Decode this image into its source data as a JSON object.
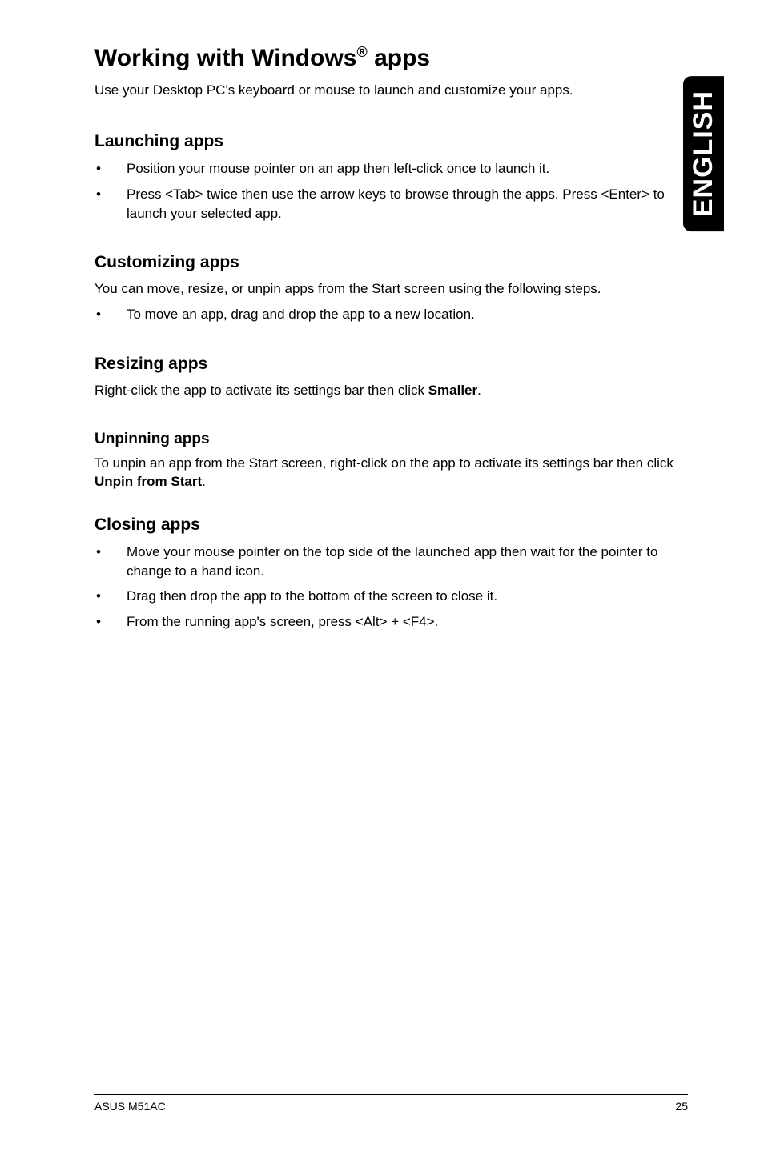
{
  "lang_tab": "ENGLISH",
  "title_prefix": "Working with Windows",
  "title_reg": "®",
  "title_suffix": " apps",
  "intro": "Use your Desktop PC's keyboard or mouse to launch and customize your apps.",
  "launching": {
    "heading": "Launching apps",
    "items": [
      "Position your mouse pointer on an app then left-click once to launch it.",
      "Press <Tab> twice then use the arrow keys to browse through the apps. Press <Enter> to launch your selected app."
    ]
  },
  "customizing": {
    "heading": "Customizing apps",
    "para": "You can move, resize, or unpin apps from the Start screen using the following steps.",
    "items": [
      "To move an app, drag and drop the app to a new location."
    ]
  },
  "resizing": {
    "heading": "Resizing apps",
    "para_before": "Right-click the app to activate its settings bar then click ",
    "bold": "Smaller",
    "para_after": "."
  },
  "unpinning": {
    "heading": "Unpinning apps",
    "para_before": "To unpin an app from the Start screen, right-click on the app to activate its settings bar then click ",
    "bold": "Unpin from Start",
    "para_after": "."
  },
  "closing": {
    "heading": "Closing apps",
    "items": [
      "Move your mouse pointer on the top side of the launched app then wait for the pointer to change to a hand icon.",
      "Drag then drop the app to the bottom of the screen to close it.",
      "From the running app's screen, press <Alt> + <F4>."
    ]
  },
  "footer": {
    "left": "ASUS M51AC",
    "right": "25"
  }
}
